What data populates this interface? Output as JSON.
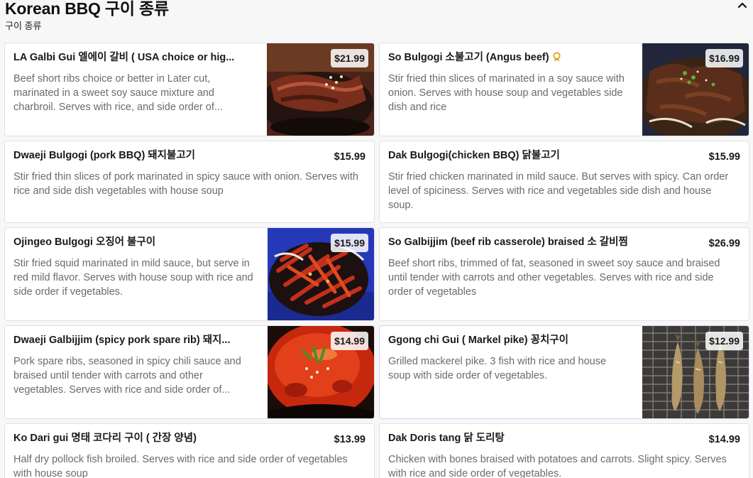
{
  "section": {
    "title": "Korean BBQ 구이 종류",
    "subtitle": "구이 종류"
  },
  "items": [
    {
      "name": "LA Galbi Gui 엘에이 갈비 ( USA choice or hig...",
      "price": "$21.99",
      "description": "Beef short ribs choice or better in Later cut, marinated in a sweet soy sauce mixture and charbroil. Serves with rice, and side order of...",
      "image": "grilled-galbi-photo"
    },
    {
      "name": "So Bulgogi 소불고기 (Angus beef)",
      "price": "$16.99",
      "description": "Stir fried thin slices of marinated in a soy sauce with onion. Serves with house soup and vegetables side dish and rice",
      "image": "beef-bulgogi-photo",
      "award_icon": "award-ribbon-icon"
    },
    {
      "name": "Dwaeji Bulgogi (pork BBQ) 돼지불고기",
      "price": "$15.99",
      "description": "Stir fried thin slices of pork marinated in spicy sauce with onion. Serves with rice and side dish vegetables with house soup"
    },
    {
      "name": "Dak Bulgogi(chicken BBQ) 닭불고기",
      "price": "$15.99",
      "description": "Stir fried chicken marinated in mild sauce. But serves with spicy. Can order level of spiciness. Serves with rice and vegetables side dish and house soup."
    },
    {
      "name": "Ojingeo Bulgogi 오징어 불구이",
      "price": "$15.99",
      "description": "Stir fried squid marinated in mild sauce, but serve in red mild flavor. Serves with house soup with rice and side order if vegetables.",
      "image": "spicy-squid-photo"
    },
    {
      "name": "So Galbijjim (beef rib casserole) braised 소 갈비찜",
      "price": "$26.99",
      "description": "Beef short ribs, trimmed of fat, seasoned in sweet soy sauce and braised until tender with carrots and other vegetables. Serves with rice and side order of vegetables"
    },
    {
      "name": "Dwaeji Galbijjim (spicy pork spare rib) 돼지...",
      "price": "$14.99",
      "description": "Pork spare ribs, seasoned in spicy chili sauce and braised until tender with carrots and other vegetables. Serves with rice and side order of...",
      "image": "spicy-pork-stew-photo"
    },
    {
      "name": "Ggong chi Gui ( Markel pike) 꽁치구이",
      "price": "$12.99",
      "description": "Grilled mackerel pike. 3 fish with rice and house soup with side order of vegetables.",
      "image": "grilled-fish-photo"
    },
    {
      "name": "Ko Dari gui 명태 코다리 구이 ( 간장 양념)",
      "price": "$13.99",
      "description": "Half dry pollock fish broiled. Serves with rice and side order of vegetables with house soup"
    },
    {
      "name": "Dak Doris tang 닭 도리탕",
      "price": "$14.99",
      "description": "Chicken with bones braised with potatoes and carrots. Slight spicy. Serves with rice and side order of vegetables."
    }
  ]
}
